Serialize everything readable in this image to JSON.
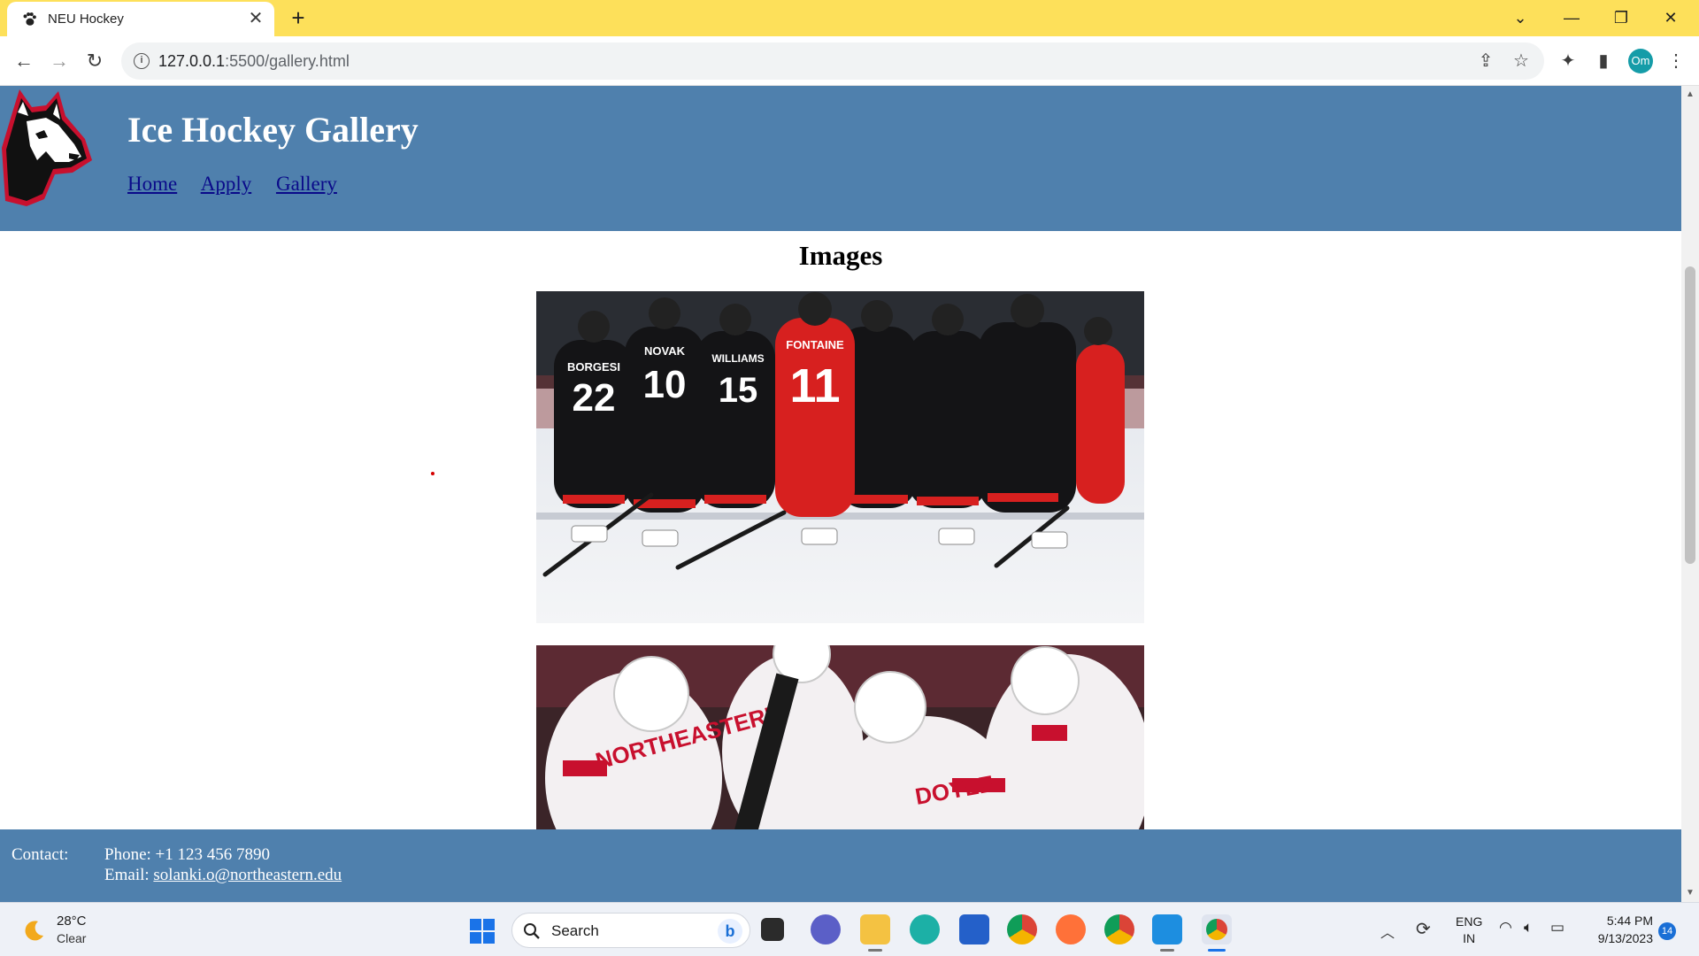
{
  "browser": {
    "tab_title": "NEU Hockey",
    "tab_close": "✕",
    "new_tab": "+",
    "url_host": "127.0.0.1",
    "url_rest": ":5500/gallery.html",
    "profile_initials": "Om",
    "theme_color": "#fde05a"
  },
  "site": {
    "title": "Ice Hockey Gallery",
    "nav": [
      "Home",
      "Apply",
      "Gallery"
    ],
    "header_color": "#4f80ad",
    "heading": "Images",
    "footer": {
      "contact_label": "Contact:",
      "phone": "Phone: +1 123 456 7890",
      "email_prefix": "Email: ",
      "email": "solanki.o@northeastern.edu"
    }
  },
  "photos": [
    {
      "name": "photo-team-huddle",
      "jersey_names": [
        "BORGESI",
        "NOVAK",
        "WILLIAMS",
        "FONTAINE"
      ],
      "jersey_numbers": [
        "22",
        "10",
        "15",
        "11"
      ]
    },
    {
      "name": "photo-celebration",
      "jersey_names": [
        "DOYLE"
      ],
      "jersey_text": "NORTHEASTERN"
    }
  ],
  "taskbar": {
    "weather_temp": "28°C",
    "weather_desc": "Clear",
    "search_label": "Search",
    "lang_line1": "ENG",
    "lang_line2": "IN",
    "time": "5:44 PM",
    "date": "9/13/2023",
    "notifications": "14",
    "icons": [
      "windows-start-icon",
      "search-icon",
      "bing-icon",
      "task-view-icon",
      "teams-chat-icon",
      "file-explorer-icon",
      "edge-icon",
      "store-icon",
      "chrome-icon",
      "firefox-icon",
      "chrome-canary-icon",
      "vscode-icon",
      "chrome-profile-icon"
    ]
  }
}
